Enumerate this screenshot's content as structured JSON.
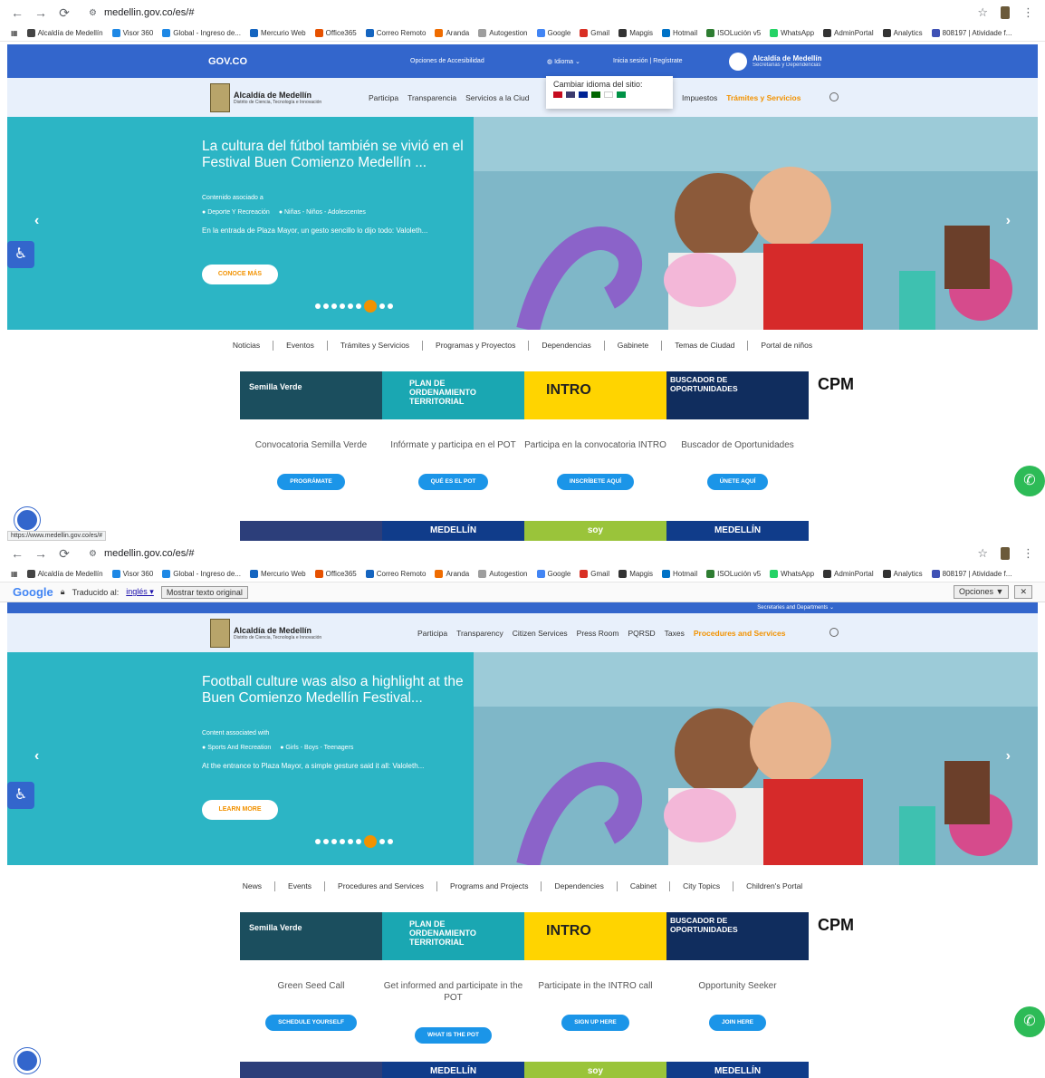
{
  "browser": {
    "url": "medellin.gov.co/es/#",
    "status_url": "https://www.medellin.gov.co/es/#",
    "bookmarks": [
      {
        "label": "Alcaldía de Medellín",
        "color": "#444444"
      },
      {
        "label": "Visor 360",
        "color": "#1e88e5"
      },
      {
        "label": "Global - Ingreso de...",
        "color": "#1e88e5"
      },
      {
        "label": "Mercurio Web",
        "color": "#1565c0"
      },
      {
        "label": "Office365",
        "color": "#e65100"
      },
      {
        "label": "Correo Remoto",
        "color": "#1565c0"
      },
      {
        "label": "Aranda",
        "color": "#ef6c00"
      },
      {
        "label": "Autogestion",
        "color": "#9e9e9e"
      },
      {
        "label": "Google",
        "color": "#4285f4"
      },
      {
        "label": "Gmail",
        "color": "#d93025"
      },
      {
        "label": "Mapgis",
        "color": "#333333"
      },
      {
        "label": "Hotmail",
        "color": "#0072c6"
      },
      {
        "label": "ISOLución v5",
        "color": "#2e7d32"
      },
      {
        "label": "WhatsApp",
        "color": "#25d366"
      },
      {
        "label": "AdminPortal",
        "color": "#333333"
      },
      {
        "label": "Analytics",
        "color": "#333333"
      },
      {
        "label": "808197 | Atividade f...",
        "color": "#3f51b5"
      }
    ]
  },
  "translate_bar": {
    "logo": "Google",
    "translated_to": "Traducido al:",
    "language": "inglés ▾",
    "show_original": "Mostrar texto original",
    "options": "Opciones ▼",
    "close": "✕"
  },
  "gov": {
    "logo": "GOV.CO",
    "accessibility": "Opciones de Accesibilidad",
    "language": "Idioma",
    "login": "Inicia sesión",
    "sep": "|",
    "register": "Regístrate",
    "alcaldia_name": "Alcaldía de Medellín",
    "alcaldia_sub": "Secretarías y Dependencias",
    "alcaldia_sub_en": "Secretaries and Departments"
  },
  "lang_popup": {
    "title": "Cambiar idioma del sitio:"
  },
  "header": {
    "logo_name": "Alcaldía de Medellín",
    "logo_sub": "Distrito de Ciencia, Tecnología e Innovación",
    "nav_es": [
      "Participa",
      "Transparencia",
      "Servicios a la Ciud"
    ],
    "nav_es_right": [
      "Impuestos",
      "Trámites y Servicios"
    ],
    "nav_en": [
      "Participa",
      "Transparency",
      "Citizen Services",
      "Press Room",
      "PQRSD",
      "Taxes",
      "Procedures and Services"
    ]
  },
  "hero_es": {
    "title": "La cultura del fútbol también se vivió en el Festival Buen Comienzo Medellín ...",
    "meta": "Contenido asociado a",
    "tag1": "Deporte Y Recreación",
    "tag2": "Niñas - Niños - Adolescentes",
    "desc": "En la entrada de Plaza Mayor, un gesto sencillo lo dijo todo: Valoleth...",
    "button": "CONOCE MÁS"
  },
  "hero_en": {
    "title": "Football culture was also a highlight at the Buen Comienzo Medellín Festival...",
    "meta": "Content associated with",
    "tag1": "Sports And Recreation",
    "tag2": "Girls - Boys - Teenagers",
    "desc": "At the entrance to Plaza Mayor, a simple gesture said it all: Valoleth...",
    "button": "LEARN MORE"
  },
  "section_nav_es": [
    "Noticias",
    "Eventos",
    "Trámites y Servicios",
    "Programas y Proyectos",
    "Dependencias",
    "Gabinete",
    "Temas de Ciudad",
    "Portal de niños"
  ],
  "section_nav_en": [
    "News",
    "Events",
    "Procedures and Services",
    "Programs and Projects",
    "Dependencies",
    "Cabinet",
    "City Topics",
    "Children's Portal"
  ],
  "banners": {
    "semilla": "Semilla Verde",
    "pot": "PLAN DE ORDENAMIENTO TERRITORIAL",
    "intro": "INTRO",
    "opp": "BUSCADOR DE OPORTUNIDADES",
    "cpm": "CPM"
  },
  "cards_es": [
    {
      "title": "Convocatoria Semilla Verde",
      "button": "PROGRÁMATE"
    },
    {
      "title": "Infórmate y participa en el POT",
      "button": "QUÉ ES EL POT"
    },
    {
      "title": "Participa en la convocatoria INTRO",
      "button": "INSCRÍBETE AQUÍ"
    },
    {
      "title": "Buscador de Oportunidades",
      "button": "ÚNETE AQUÍ"
    }
  ],
  "cards_en": [
    {
      "title": "Green Seed Call",
      "button": "SCHEDULE YOURSELF"
    },
    {
      "title": "Get informed and participate in the POT",
      "button": "WHAT IS THE POT"
    },
    {
      "title": "Participate in the INTRO call",
      "button": "SIGN UP HERE"
    },
    {
      "title": "Opportunity Seeker",
      "button": "JOIN HERE"
    }
  ],
  "bottom_strip": {
    "medellin1": "MEDELLÍN",
    "soy": "soy",
    "medellin2": "MEDELLÍN"
  },
  "colors": {
    "gov_blue": "#3366cc",
    "hero_teal": "#2cb5c5",
    "accent_orange": "#f29200",
    "button_blue": "#1b95e8",
    "whatsapp_green": "#2dbb57"
  }
}
